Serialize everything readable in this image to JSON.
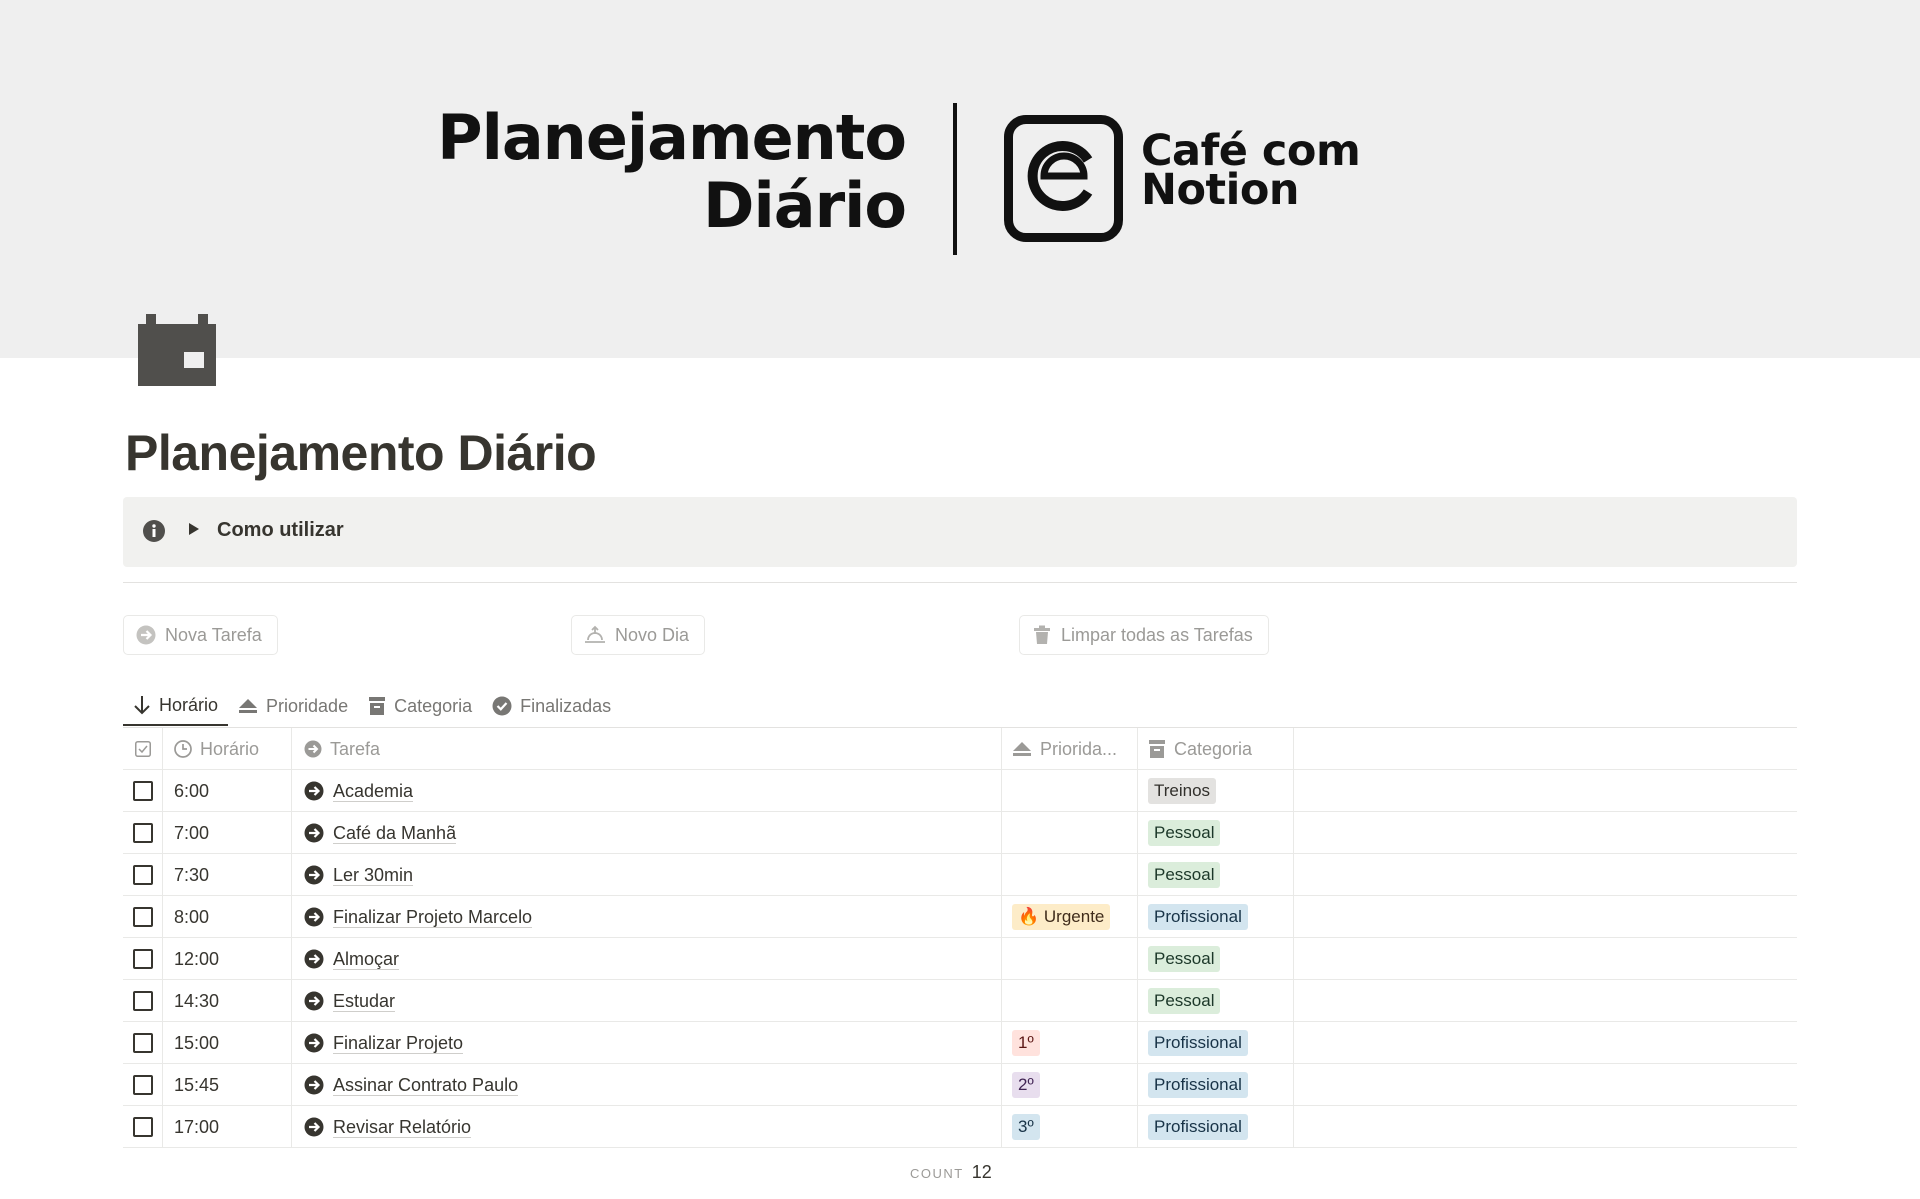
{
  "cover": {
    "title_line1": "Planejamento",
    "title_line2": "Diário",
    "brand_line1": "Café com",
    "brand_line2": "Notion"
  },
  "page": {
    "icon": "calendar-icon",
    "title": "Planejamento Diário"
  },
  "callout": {
    "icon": "info-icon",
    "label": "Como utilizar"
  },
  "buttons": {
    "new_task": "Nova Tarefa",
    "new_day": "Novo Dia",
    "clear_all": "Limpar todas as Tarefas"
  },
  "tabs": [
    {
      "label": "Horário",
      "icon": "arrow-down-icon",
      "active": true
    },
    {
      "label": "Prioridade",
      "icon": "priority-icon",
      "active": false
    },
    {
      "label": "Categoria",
      "icon": "archive-icon",
      "active": false
    },
    {
      "label": "Finalizadas",
      "icon": "check-circle-icon",
      "active": false
    }
  ],
  "table": {
    "columns": {
      "time": "Horário",
      "task": "Tarefa",
      "priority": "Priorida...",
      "category": "Categoria"
    },
    "rows": [
      {
        "time": "6:00",
        "task": "Academia",
        "priority": "",
        "category": "Treinos",
        "checked": false
      },
      {
        "time": "7:00",
        "task": "Café da Manhã",
        "priority": "",
        "category": "Pessoal",
        "checked": false
      },
      {
        "time": "7:30",
        "task": "Ler 30min",
        "priority": "",
        "category": "Pessoal",
        "checked": false
      },
      {
        "time": "8:00",
        "task": "Finalizar Projeto Marcelo",
        "priority": "🔥 Urgente",
        "category": "Profissional",
        "checked": false
      },
      {
        "time": "12:00",
        "task": "Almoçar",
        "priority": "",
        "category": "Pessoal",
        "checked": false
      },
      {
        "time": "14:30",
        "task": "Estudar",
        "priority": "",
        "category": "Pessoal",
        "checked": false
      },
      {
        "time": "15:00",
        "task": "Finalizar Projeto",
        "priority": "1º",
        "category": "Profissional",
        "checked": false
      },
      {
        "time": "15:45",
        "task": "Assinar Contrato Paulo",
        "priority": "2º",
        "category": "Profissional",
        "checked": false
      },
      {
        "time": "17:00",
        "task": "Revisar Relatório",
        "priority": "3º",
        "category": "Profissional",
        "checked": false
      }
    ],
    "count_label": "COUNT",
    "count_value": "12"
  }
}
